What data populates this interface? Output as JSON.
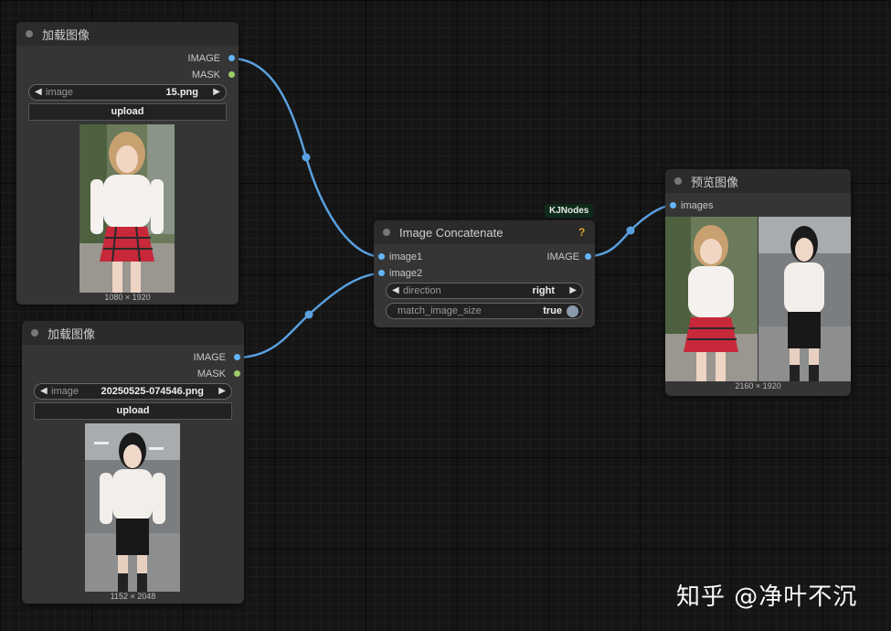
{
  "nodes": {
    "load1": {
      "title": "加载图像",
      "outputs": [
        "IMAGE",
        "MASK"
      ],
      "image_label": "image",
      "image_value": "15.png",
      "upload_label": "upload",
      "size": "1080 × 1920"
    },
    "load2": {
      "title": "加载图像",
      "outputs": [
        "IMAGE",
        "MASK"
      ],
      "image_label": "image",
      "image_value": "20250525-074546.png",
      "upload_label": "upload",
      "size": "1152 × 2048"
    },
    "concat": {
      "badge": "KJNodes",
      "help": "?",
      "title": "Image Concatenate",
      "inputs": [
        "image1",
        "image2"
      ],
      "output": "IMAGE",
      "direction_label": "direction",
      "direction_value": "right",
      "match_label": "match_image_size",
      "match_value": "true"
    },
    "preview": {
      "title": "预览图像",
      "input": "images",
      "size": "2160 × 1920"
    }
  },
  "watermark": "知乎 @净叶不沉",
  "colors": {
    "wire": "#5aa0e0",
    "image_port": "#64b5f6",
    "mask_port": "#9ccc65",
    "node_body": "#353535",
    "node_title": "#2b2b2b",
    "badge": "#0e2a1a"
  },
  "icons": {
    "arrow_left": "◀",
    "arrow_right": "▶"
  }
}
